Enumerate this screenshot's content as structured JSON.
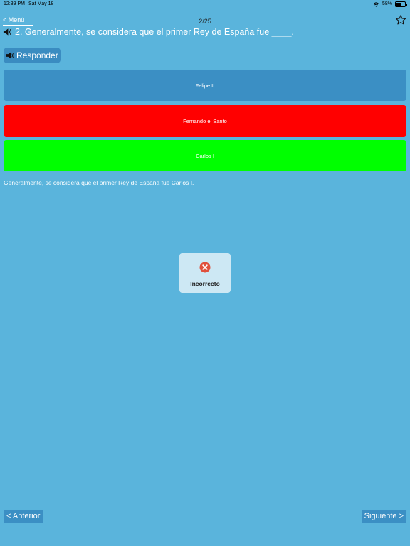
{
  "status_bar": {
    "time": "12:39 PM",
    "date": "Sat May 18",
    "battery": "58%"
  },
  "nav": {
    "menu_label": "< Menú",
    "counter": "2/25"
  },
  "question": {
    "text": "2. Generalmente, se considera que el primer Rey de España fue ____."
  },
  "respond_button": {
    "label": "Responder"
  },
  "options": [
    {
      "label": "Felipe II",
      "color": "#3b8fc4"
    },
    {
      "label": "Fernando el Santo",
      "color": "#ff0000"
    },
    {
      "label": "Carlos I",
      "color": "#00ff00"
    }
  ],
  "explanation": "Generalmente, se considera que el primer Rey de España fue Carlos I.",
  "result": {
    "text": "Incorrecto",
    "icon": "x-circle-icon",
    "icon_color": "#e0503c"
  },
  "footer": {
    "prev_label": "< Anterior",
    "next_label": "Siguiente >"
  },
  "colors": {
    "background": "#5ab4dc",
    "accent": "#3b8fc4"
  }
}
